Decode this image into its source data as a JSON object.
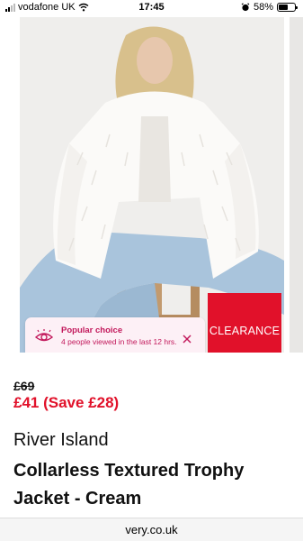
{
  "status_bar": {
    "carrier": "vodafone UK",
    "time": "17:45",
    "battery": "58%",
    "battery_level": 0.58
  },
  "product": {
    "badge": "CLEARANCE",
    "popular": {
      "title": "Popular choice",
      "text": "4 people viewed in the last 12 hrs."
    },
    "was_price": "£69",
    "now_price": "£41 (Save £28)",
    "brand": "River Island",
    "title": "Collarless Textured Trophy Jacket - Cream"
  },
  "browser": {
    "url": "very.co.uk"
  },
  "colors": {
    "sale_red": "#e1112a",
    "popular_pink": "#c2185b",
    "popular_bg": "#fdf0f6"
  },
  "icons": {
    "signal": "signal-icon",
    "wifi": "wifi-icon",
    "alarm": "alarm-icon",
    "battery": "battery-icon",
    "eye": "eye-icon",
    "close": "close-icon"
  }
}
